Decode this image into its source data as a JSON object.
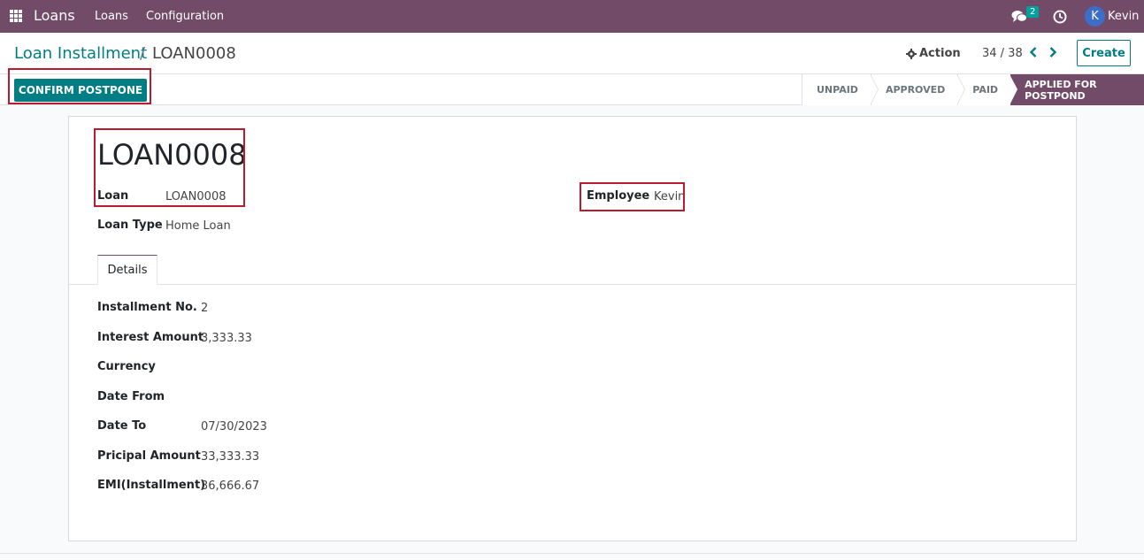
{
  "navbar": {
    "app_name": "Loans",
    "menus": [
      "Loans",
      "Configuration"
    ],
    "chat_count": "2",
    "user_initial": "K",
    "user_name": "Kevin"
  },
  "breadcrumb": {
    "parent": "Loan Installment",
    "separator": "/",
    "current": "LOAN0008"
  },
  "control": {
    "action_label": "Action",
    "pager": "34 / 38",
    "create_label": "Create",
    "confirm_label": "CONFIRM POSTPONE"
  },
  "statusbar": {
    "stages": [
      "UNPAID",
      "APPROVED",
      "PAID",
      "APPLIED FOR POSTPOND"
    ],
    "active": "APPLIED FOR POSTPOND"
  },
  "form": {
    "title": "LOAN0008",
    "loan_label": "Loan",
    "loan_value": "LOAN0008",
    "loan_type_label": "Loan Type",
    "loan_type_value": "Home Loan",
    "employee_label": "Employee",
    "employee_value": "Kevin",
    "tab_label": "Details",
    "fields": [
      {
        "label": "Installment No.",
        "value": "2"
      },
      {
        "label": "Interest Amount",
        "value": "3,333.33"
      },
      {
        "label": "Currency",
        "value": ""
      },
      {
        "label": "Date From",
        "value": ""
      },
      {
        "label": "Date To",
        "value": "07/30/2023"
      },
      {
        "label": "Pricipal Amount",
        "value": "33,333.33"
      },
      {
        "label": "EMI(Installment)",
        "value": "36,666.67"
      }
    ]
  },
  "colors": {
    "brand": "#714b67",
    "accent": "#017e84",
    "highlight": "#b91c2e"
  }
}
